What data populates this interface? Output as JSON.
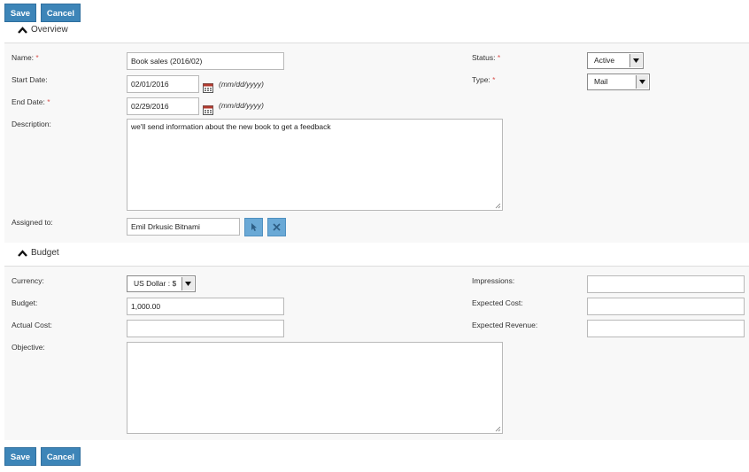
{
  "toolbar": {
    "save_label": "Save",
    "cancel_label": "Cancel"
  },
  "overview": {
    "title": "Overview",
    "name_label": "Name:",
    "name_value": "Book sales (2016/02)",
    "start_label": "Start Date:",
    "start_value": "02/01/2016",
    "end_label": "End Date:",
    "end_value": "02/29/2016",
    "date_hint": "(mm/dd/yyyy)",
    "description_label": "Description:",
    "description_value": "we'll send information about the new book to get a feedback",
    "assigned_label": "Assigned to:",
    "assigned_value": "Emil Drkusic Bitnami",
    "status_label": "Status:",
    "status_value": "Active",
    "type_label": "Type:",
    "type_value": "Mail",
    "required_mark": "*"
  },
  "budget": {
    "title": "Budget",
    "currency_label": "Currency:",
    "currency_value": "US Dollar : $",
    "budget_label": "Budget:",
    "budget_value": "1,000.00",
    "actual_cost_label": "Actual Cost:",
    "actual_cost_value": "",
    "objective_label": "Objective:",
    "objective_value": "",
    "impressions_label": "Impressions:",
    "impressions_value": "",
    "expected_cost_label": "Expected Cost:",
    "expected_cost_value": "",
    "expected_revenue_label": "Expected Revenue:",
    "expected_revenue_value": ""
  },
  "colors": {
    "button": "#3d85b8",
    "required": "#d9534f",
    "icon_button": "#6aa9d6"
  },
  "icons": [
    "caret-up-icon",
    "calendar-icon",
    "select-user-icon",
    "clear-icon",
    "dropdown-arrow-icon",
    "resize-grip-icon"
  ]
}
